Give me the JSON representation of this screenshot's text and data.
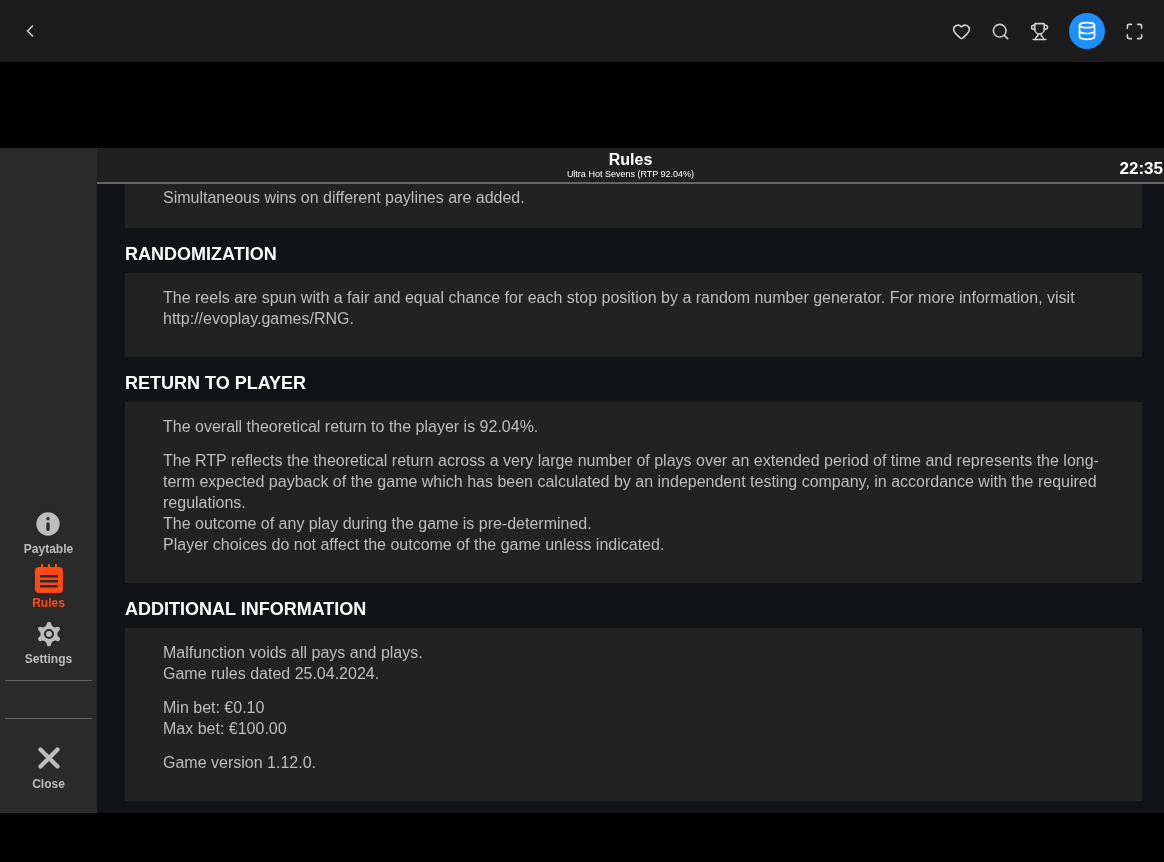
{
  "top_bar": {
    "icons": [
      {
        "kind": "back"
      },
      {
        "kind": "heart"
      },
      {
        "kind": "search"
      },
      {
        "kind": "trophy"
      },
      {
        "kind": "database",
        "selected": true
      },
      {
        "kind": "fullscreen"
      }
    ]
  },
  "sidebar": {
    "items": [
      {
        "kind": "info",
        "label": "Paytable",
        "selected": false
      },
      {
        "kind": "rules",
        "label": "Rules",
        "selected": true
      },
      {
        "kind": "settings",
        "label": "Settings",
        "selected": false
      }
    ],
    "close": {
      "label": "Close"
    }
  },
  "header": {
    "title": "Rules",
    "subtitle": "Ultra Hot Sevens (RTP 92.04%)",
    "clock": "22:35"
  },
  "sections": [
    {
      "blocks": [
        [
          "Simultaneous wins on different paylines are added."
        ]
      ]
    },
    {
      "heading": "RANDOMIZATION",
      "blocks": [
        [
          "The reels are spun with a fair and equal chance for each stop position by a random number generator. For more information, visit http://evoplay.games/RNG."
        ]
      ]
    },
    {
      "heading": "RETURN TO PLAYER",
      "blocks": [
        [
          "The overall theoretical return to the player is 92.04%."
        ],
        [
          "The RTP reflects the theoretical return across a very large number of plays over an extended period of time and represents the long-term expected payback of the game which has been calculated by an independent testing company, in accordance with the required regulations.",
          "The outcome of any play during the game is pre-determined.",
          "Player choices do not affect the outcome of the game unless indicated."
        ]
      ]
    },
    {
      "heading": "ADDITIONAL INFORMATION",
      "blocks": [
        [
          "Malfunction voids all pays and plays.",
          "Game rules dated 25.04.2024."
        ],
        [
          "Min bet: €0.10",
          "Max bet: €100.00"
        ],
        [
          "Game version 1.12.0."
        ]
      ]
    }
  ]
}
